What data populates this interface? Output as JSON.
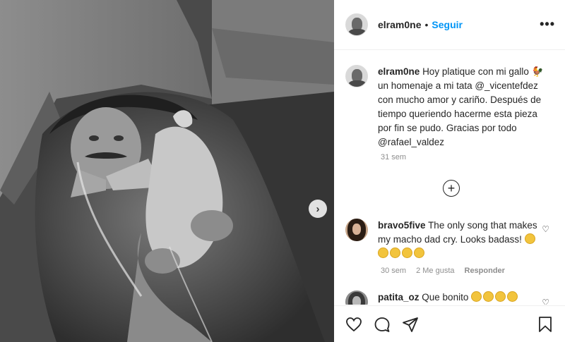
{
  "post": {
    "username": "elram0ne",
    "follow_label": "Seguir",
    "separator": "•",
    "more_label": "•••",
    "next_label": "›"
  },
  "caption": {
    "username": "elram0ne",
    "text": "Hoy platique con mi gallo 🐓 un homenaje a mi tata @_vicentefdez con mucho amor y cariño. Después de tiempo queriendo hacerme esta pieza por fin se pudo. Gracias por todo @rafael_valdez",
    "time": "31 sem"
  },
  "load_more_label": "+",
  "comments": [
    {
      "username": "bravo5five",
      "text": "The only song that makes my macho dad cry. Looks badass!",
      "time": "30 sem",
      "likes": "2 Me gusta",
      "reply_label": "Responder",
      "emoji_count": 5
    },
    {
      "username": "patita_oz",
      "text": "Que bonito",
      "emoji_count": 4
    }
  ],
  "icons": {
    "like": "heart-icon",
    "comment": "comment-icon",
    "share": "paper-plane-icon",
    "save": "bookmark-icon"
  },
  "colors": {
    "link_blue": "#0095f6",
    "text": "#262626",
    "meta_gray": "#8e8e8e"
  }
}
